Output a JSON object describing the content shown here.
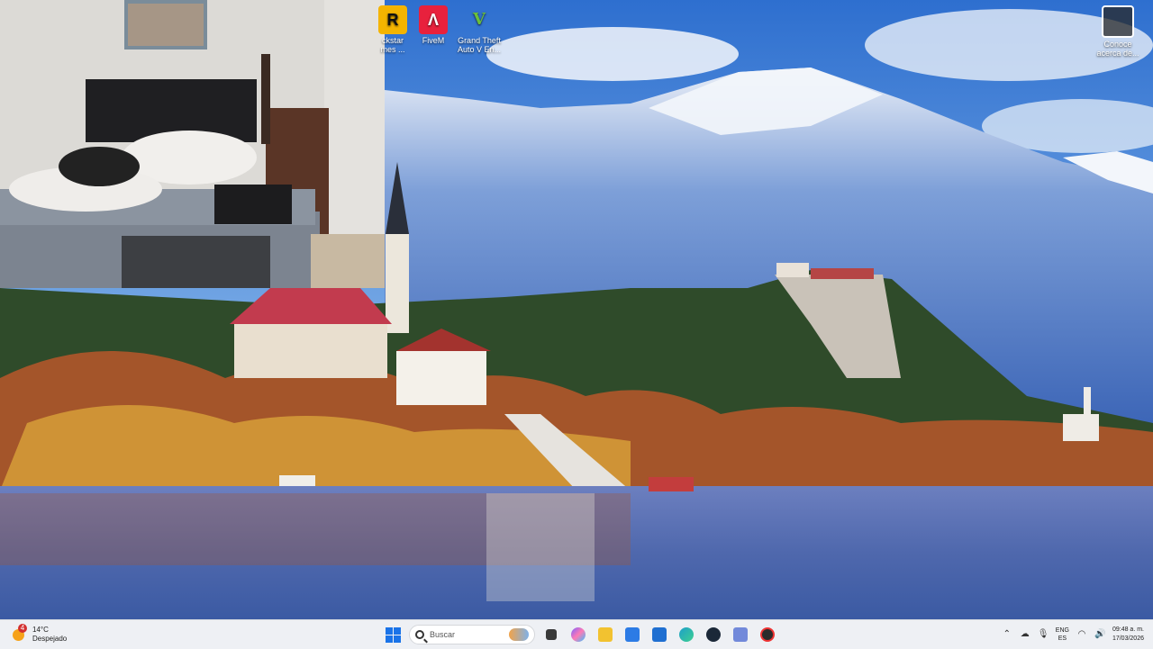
{
  "desktop_icons": [
    {
      "id": "rockstar",
      "glyph": "R",
      "label_line1": "ckstar",
      "label_line2": "mes ..."
    },
    {
      "id": "fivem",
      "glyph": "Λ",
      "label_line1": "FiveM",
      "label_line2": ""
    },
    {
      "id": "gta",
      "glyph": "V",
      "label_line1": "Grand Theft",
      "label_line2": "Auto V En..."
    },
    {
      "id": "conoce",
      "glyph": "",
      "label_line1": "Conoce",
      "label_line2": "acerca de..."
    }
  ],
  "taskbar": {
    "weather": {
      "badge": "4",
      "temp": "14°C",
      "condition": "Despejado"
    },
    "search_placeholder": "Buscar",
    "apps": [
      {
        "name": "task-view",
        "color": "#3a3a3a"
      },
      {
        "name": "copilot",
        "color": "#7b61ff"
      },
      {
        "name": "file-explorer",
        "color": "#f2c230"
      },
      {
        "name": "store",
        "color": "#2c7be5"
      },
      {
        "name": "outlook",
        "color": "#1f6fd1"
      },
      {
        "name": "edge",
        "color": "#1fa0c9"
      },
      {
        "name": "steam",
        "color": "#1b2838"
      },
      {
        "name": "discord",
        "color": "#7289da"
      },
      {
        "name": "obs",
        "color": "#2b2b2b"
      }
    ],
    "tray": {
      "lang_primary": "ENG",
      "lang_secondary": "ES",
      "time": "09:48 a. m.",
      "date": "17/03/2026"
    }
  }
}
